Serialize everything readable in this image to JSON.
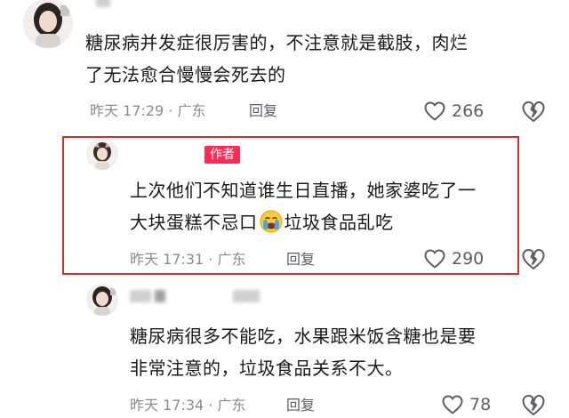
{
  "comments": [
    {
      "lines": [
        "糖尿病并发症很厉害的，不注意就是截肢，肉烂",
        "了无法愈合慢慢会死去的"
      ],
      "meta": "昨天 17:29 · 广东",
      "reply_label": "回复",
      "likes": "266"
    },
    {
      "badge": "作者",
      "line1": "上次他们不知道谁生日直播，她家婆吃了一",
      "line2_before": "大块蛋糕不忌口",
      "emoji": "crying-face-emoji",
      "line2_after": "垃圾食品乱吃",
      "meta": "昨天 17:31 · 广东",
      "reply_label": "回复",
      "likes": "290"
    },
    {
      "lines": [
        "糖尿病很多不能吃，水果跟米饭含糖也是要",
        "非常注意的，垃圾食品关系不大。"
      ],
      "meta": "昨天 17:34 · 广东",
      "reply_label": "回复",
      "likes": "78"
    }
  ],
  "colors": {
    "text": "#1a1a1a",
    "meta": "#8a8b91",
    "author_badge": "#fe2c55",
    "highlight_border": "#d62d24"
  },
  "icons": {
    "like": "heart-outline-icon",
    "dislike": "broken-heart-icon"
  }
}
